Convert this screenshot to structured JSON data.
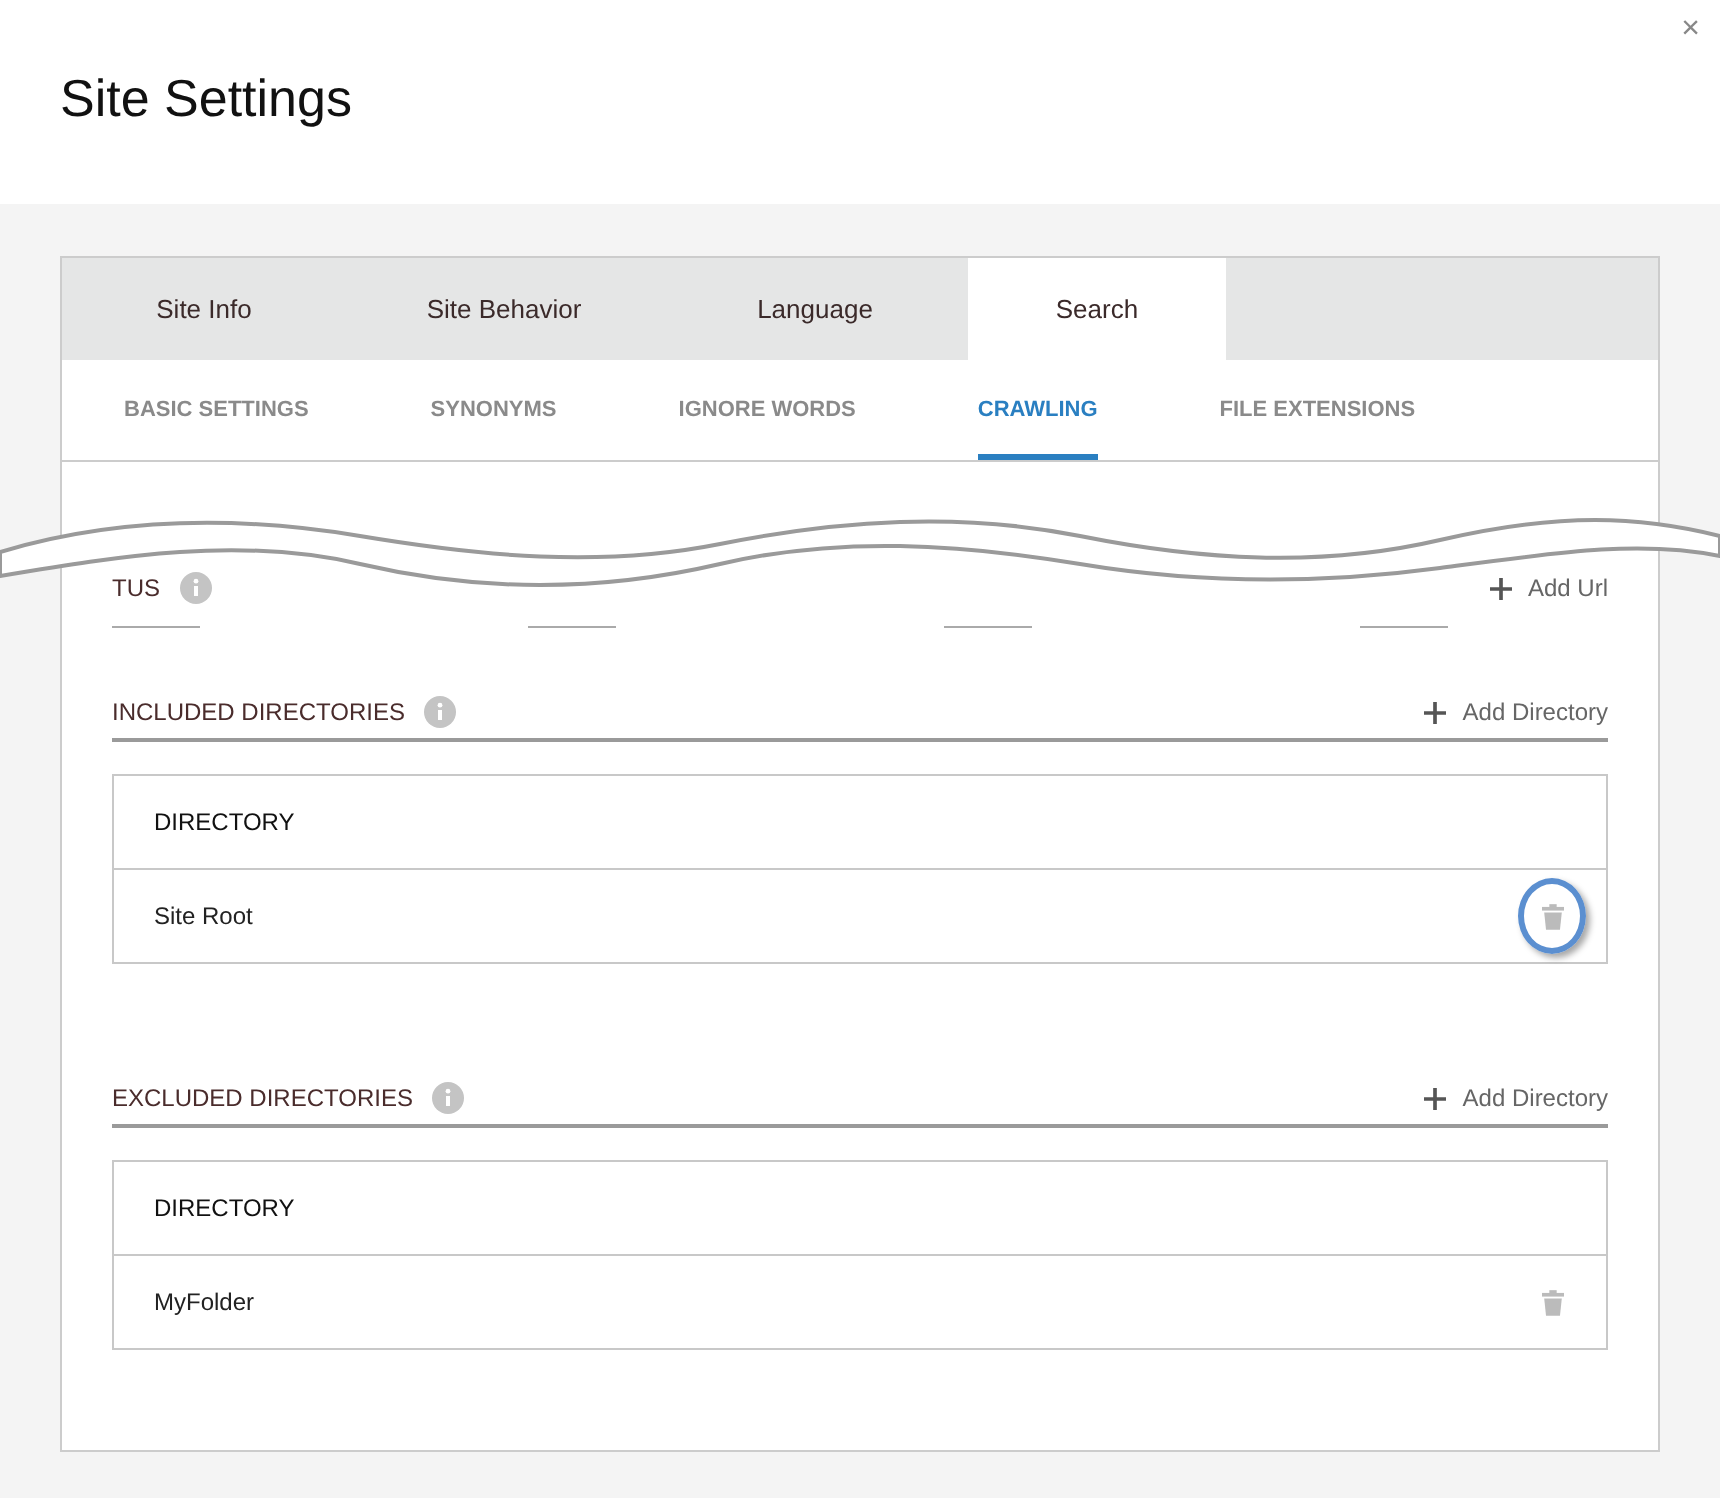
{
  "dialog": {
    "title": "Site Settings",
    "close_icon": "×"
  },
  "tabs": [
    {
      "label": "Site Info",
      "selected": false
    },
    {
      "label": "Site Behavior",
      "selected": false
    },
    {
      "label": "Language",
      "selected": false
    },
    {
      "label": "Search",
      "selected": true
    }
  ],
  "subtabs": [
    {
      "label": "BASIC SETTINGS",
      "selected": false
    },
    {
      "label": "SYNONYMS",
      "selected": false
    },
    {
      "label": "IGNORE WORDS",
      "selected": false
    },
    {
      "label": "CRAWLING",
      "selected": true
    },
    {
      "label": "FILE EXTENSIONS",
      "selected": false
    }
  ],
  "cut_section": {
    "title": "TUS",
    "action": "Add Url"
  },
  "sections": [
    {
      "title": "INCLUDED DIRECTORIES",
      "action": "Add Directory",
      "column": "DIRECTORY",
      "rows": [
        {
          "name": "Site Root",
          "highlighted": true
        }
      ]
    },
    {
      "title": "EXCLUDED DIRECTORIES",
      "action": "Add Directory",
      "column": "DIRECTORY",
      "rows": [
        {
          "name": "MyFolder",
          "highlighted": false
        }
      ]
    }
  ]
}
